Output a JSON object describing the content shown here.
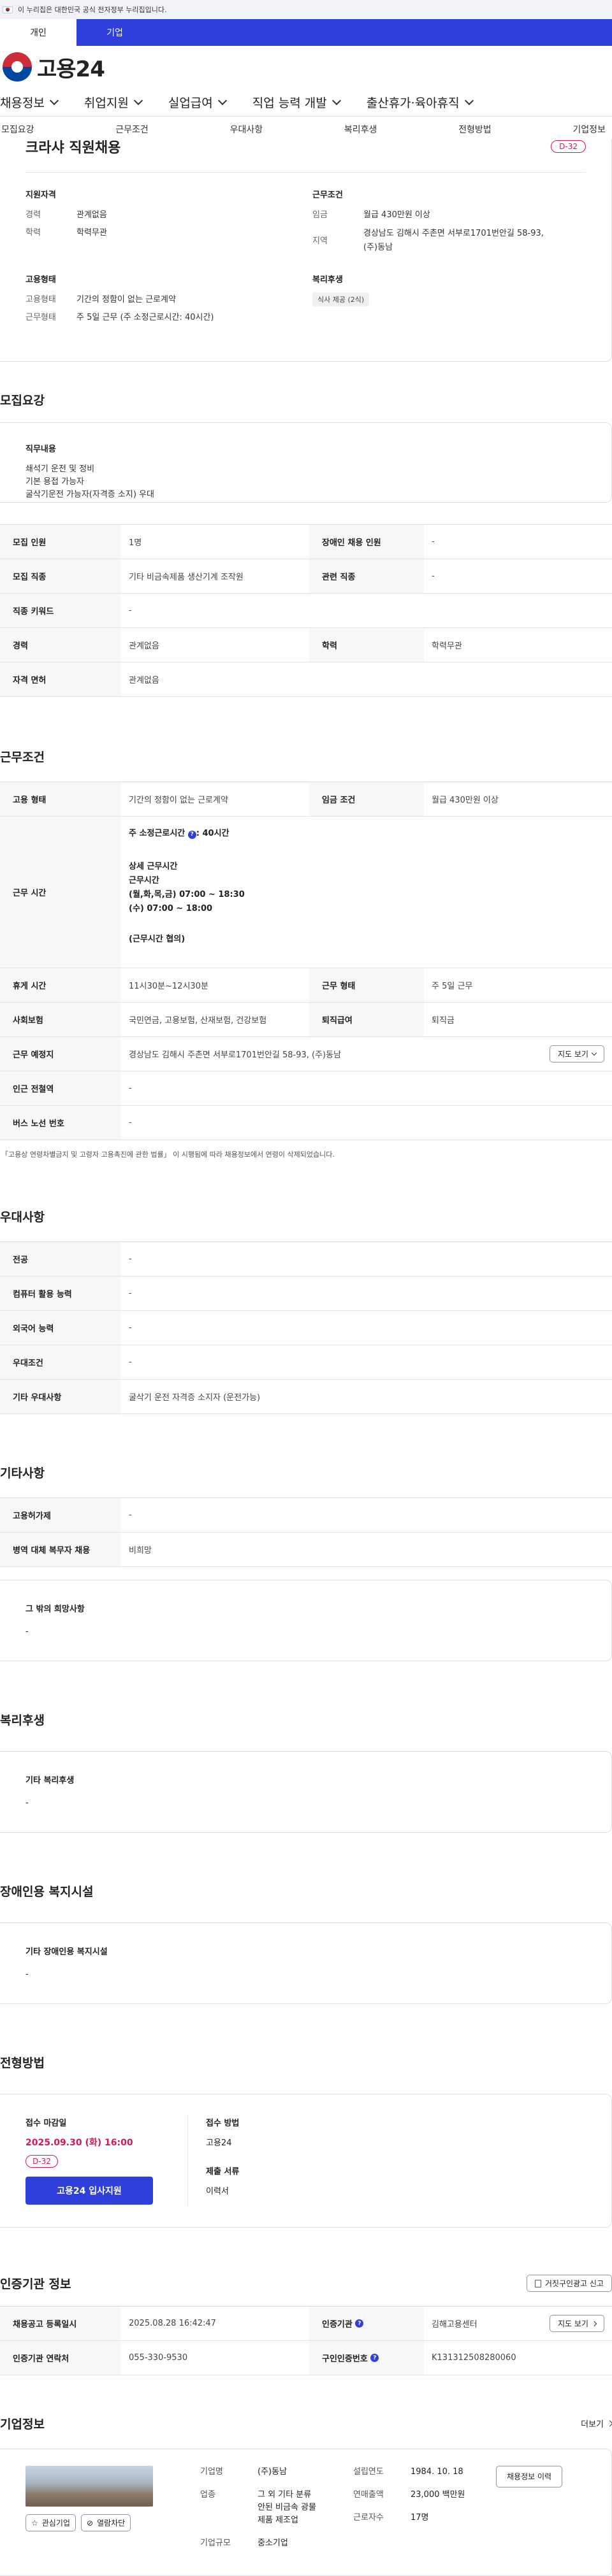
{
  "gov_banner": "이 누리집은 대한민국 공식 전자정부 누리집입니다.",
  "user_tabs": [
    "개인",
    "기업"
  ],
  "logo": "고용24",
  "gnb": [
    "채용정보",
    "취업지원",
    "실업급여",
    "직업 능력 개발",
    "출산휴가·육아휴직"
  ],
  "anchors": [
    "모집요강",
    "근무조건",
    "우대사항",
    "복리후생",
    "전형방법",
    "기업정보"
  ],
  "job": {
    "title": "크라샤 직원채용",
    "dday": "D-32",
    "qual_h": "지원자격",
    "career_k": "경력",
    "career_v": "관계없음",
    "edu_k": "학력",
    "edu_v": "학력무관",
    "cond_h": "근무조건",
    "wage_k": "임금",
    "wage_v": "월급 430만원 이상",
    "area_k": "지역",
    "area_v1": "경상남도 김해시 주촌면 서부로1701번안길 58-93,",
    "area_v2": "(주)동남",
    "emp_h": "고용형태",
    "emp_k": "고용형태",
    "emp_v": "기간의 정함이 없는 근로계약",
    "work_k": "근무형태",
    "work_v": "주 5일 근무 (주 소정근로시간: 40시간)",
    "welfare_h": "복리후생",
    "welfare_tag": "식사 제공 (2식)"
  },
  "recruit": {
    "heading": "모집요강",
    "duty_h": "직무내용",
    "duty_lines": [
      "쇄석기 운전 및 정비",
      "기본 용접 가능자",
      "굴삭기운전 가능자(자격증 소지) 우대"
    ],
    "rows": [
      {
        "k1": "모집 인원",
        "v1": "1명",
        "k2": "장애인 채용 인원",
        "v2": "-"
      },
      {
        "k1": "모집 직종",
        "v1": "기타 비금속제품 생산기계 조작원",
        "k2": "관련 직종",
        "v2": "-"
      },
      {
        "k1": "직종 키워드",
        "v1": "-"
      },
      {
        "k1": "경력",
        "v1": "관계없음",
        "k2": "학력",
        "v2": "학력무관"
      },
      {
        "k1": "자격 면허",
        "v1": "관계없음"
      }
    ]
  },
  "cond": {
    "heading": "근무조건",
    "emp_k": "고용 형태",
    "emp_v": "기간의 정함이 없는 근로계약",
    "wage_k": "임금 조건",
    "wage_v": "월급 430만원 이상",
    "hours_k": "근무 시간",
    "hours_weekly": "주 소정근로시간",
    "hours_weekly_v": ": 40시간",
    "hours_detail_h": "상세 근무시간",
    "hours_detail_lines": [
      "근무시간",
      "(월,화,목,금) 07:00 ~ 18:30",
      "(수) 07:00 ~ 18:00"
    ],
    "hours_note": "(근무시간 협의)",
    "break_k": "휴게 시간",
    "break_v": "11시30분~12시30분",
    "type_k": "근무 형태",
    "type_v": "주 5일 근무",
    "ins_k": "사회보험",
    "ins_v": "국민연금, 고용보험, 산재보험, 건강보험",
    "retire_k": "퇴직급여",
    "retire_v": "퇴직금",
    "place_k": "근무 예정지",
    "place_v": "경상남도 김해시 주촌면 서부로1701번안길 58-93, (주)동남",
    "map_btn": "지도 보기",
    "subway_k": "인근 전철역",
    "subway_v": "-",
    "bus_k": "버스 노선 번호",
    "bus_v": "-",
    "note": "「고용상 연령차별금지 및 고령자 고용촉진에 관한 법률」 이 시행됨에 따라 채용정보에서 연령이 삭제되었습니다."
  },
  "pref": {
    "heading": "우대사항",
    "rows": [
      {
        "k": "전공",
        "v": "-"
      },
      {
        "k": "컴퓨터 활용 능력",
        "v": "-"
      },
      {
        "k": "외국어 능력",
        "v": "-"
      },
      {
        "k": "우대조건",
        "v": "-"
      },
      {
        "k": "기타 우대사항",
        "v": "굴삭기 운전 자격증 소지자 (운전가능)"
      }
    ]
  },
  "etc": {
    "heading": "기타사항",
    "rows": [
      {
        "k": "고용허가제",
        "v": "-"
      },
      {
        "k": "병역 대체 복무자 채용",
        "v": "비희망"
      }
    ],
    "box_h": "그 밖의 희망사항",
    "box_v": "-"
  },
  "welfare": {
    "heading": "복리후생",
    "box_h": "기타 복리후생",
    "box_v": "-"
  },
  "disabled": {
    "heading": "장애인용 복지시설",
    "box_h": "기타 장애인용 복지시설",
    "box_v": "-"
  },
  "selection": {
    "heading": "전형방법",
    "deadline_h": "접수 마감일",
    "deadline_v": "2025.09.30 (화) 16:00",
    "dday": "D-32",
    "apply_btn": "고용24 입사지원",
    "method_h": "접수 방법",
    "method_v": "고용24",
    "docs_h": "제출 서류",
    "docs_v": "이력서"
  },
  "agency": {
    "heading": "인증기관 정보",
    "report_btn": "거짓구인광고 신고",
    "reg_k": "채용공고 등록일시",
    "reg_v": "2025.08.28 16:42:47",
    "org_k": "인증기관",
    "org_v": "김해고용센터",
    "map_btn": "지도 보기",
    "tel_k": "인증기관 연락처",
    "tel_v": "055-330-9530",
    "num_k": "구인인증번호",
    "num_v": "K131312508280060"
  },
  "company": {
    "heading": "기업정보",
    "more": "더보기",
    "fav_btn": "관심기업",
    "block_btn": "열람차단",
    "name_k": "기업명",
    "name_v": "(주)동남",
    "ind_k": "업종",
    "ind_v_lines": [
      "그 외 기타 분류",
      "안된 비금속 광물",
      "제품 제조업"
    ],
    "size_k": "기업규모",
    "size_v": "중소기업",
    "est_k": "설립연도",
    "est_v": "1984. 10. 18",
    "sales_k": "연매출액",
    "sales_v": "23,000 백만원",
    "emp_k": "근로자수",
    "emp_v": "17명",
    "history_btn": "채용정보 이력"
  },
  "colors": {
    "brand": "#2f3fdc",
    "accent": "#d6175c"
  }
}
